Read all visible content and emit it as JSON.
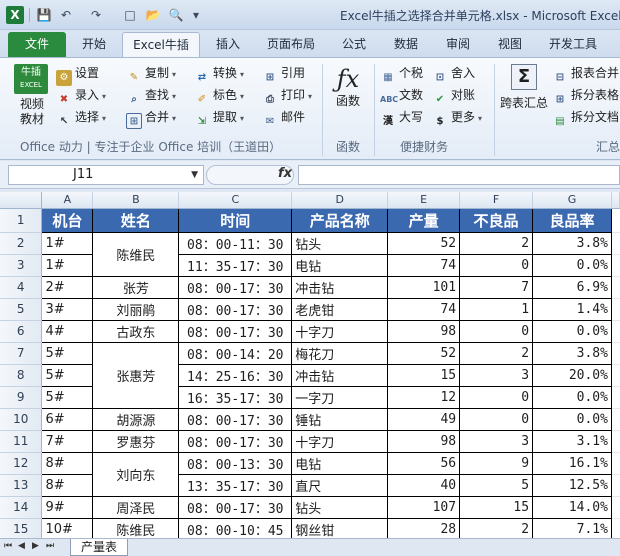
{
  "window": {
    "title": "Excel牛插之选择合并单元格.xlsx - Microsoft Excel"
  },
  "quick_access": {
    "logo": "X",
    "save": "💾",
    "undo": "↶",
    "redo": "↷",
    "new": "□",
    "open": "📂",
    "print": "🔍",
    "more": "▾"
  },
  "tabs": [
    "文件",
    "开始",
    "Excel牛插",
    "插入",
    "页面布局",
    "公式",
    "数据",
    "审阅",
    "视图",
    "开发工具"
  ],
  "ribbon": {
    "logo_top": "牛插",
    "logo_bottom": "EXCEL",
    "logo_caption": "视频\n教材",
    "col1": [
      "设置",
      "录入",
      "选择"
    ],
    "col2": [
      "复制",
      "查找",
      "合并"
    ],
    "col3": [
      "转换",
      "标色",
      "提取"
    ],
    "col4": [
      "引用",
      "打印",
      "邮件"
    ],
    "group1_label": "Office 动力 | 专注于企业 Office 培训（王道田）",
    "func_btn": "函数",
    "func_label": "函数",
    "col5": [
      "个税",
      "文数",
      "大写"
    ],
    "col6": [
      "舍入",
      "对账",
      "更多"
    ],
    "group3_label": "便捷财务",
    "kuabiao": "跨表汇总",
    "col7": [
      "报表合并",
      "拆分表格",
      "拆分文档"
    ],
    "group4_label": "汇总"
  },
  "formula_bar": {
    "name_box": "J11",
    "fx": "fx",
    "formula": ""
  },
  "columns": [
    "A",
    "B",
    "C",
    "D",
    "E",
    "F",
    "G"
  ],
  "table": {
    "headers": [
      "机台",
      "姓名",
      "时间",
      "产品名称",
      "产量",
      "不良品",
      "良品率"
    ],
    "rows": [
      {
        "n": "2",
        "a": "1#",
        "b": "陈维民",
        "b_span": 2,
        "c": "08：00-11：30",
        "d": "钻头",
        "e": "52",
        "f": "2",
        "g": "3.8%"
      },
      {
        "n": "3",
        "a": "1#",
        "c": "11：35-17：30",
        "d": "电钻",
        "e": "74",
        "f": "0",
        "g": "0.0%"
      },
      {
        "n": "4",
        "a": "2#",
        "b": "张芳",
        "b_span": 1,
        "c": "08：00-17：30",
        "d": "冲击钻",
        "e": "101",
        "f": "7",
        "g": "6.9%"
      },
      {
        "n": "5",
        "a": "3#",
        "b": "刘丽鹃",
        "b_span": 1,
        "c": "08：00-17：30",
        "d": "老虎钳",
        "e": "74",
        "f": "1",
        "g": "1.4%"
      },
      {
        "n": "6",
        "a": "4#",
        "b": "古政东",
        "b_span": 1,
        "c": "08：00-17：30",
        "d": "十字刀",
        "e": "98",
        "f": "0",
        "g": "0.0%"
      },
      {
        "n": "7",
        "a": "5#",
        "b": "张惠芳",
        "b_span": 3,
        "c": "08：00-14：20",
        "d": "梅花刀",
        "e": "52",
        "f": "2",
        "g": "3.8%"
      },
      {
        "n": "8",
        "a": "5#",
        "c": "14：25-16：30",
        "d": "冲击钻",
        "e": "15",
        "f": "3",
        "g": "20.0%"
      },
      {
        "n": "9",
        "a": "5#",
        "c": "16：35-17：30",
        "d": "一字刀",
        "e": "12",
        "f": "0",
        "g": "0.0%"
      },
      {
        "n": "10",
        "a": "6#",
        "b": "胡源源",
        "b_span": 1,
        "c": "08：00-17：30",
        "d": "锤钻",
        "e": "49",
        "f": "0",
        "g": "0.0%"
      },
      {
        "n": "11",
        "a": "7#",
        "b": "罗惠芬",
        "b_span": 1,
        "c": "08：00-17：30",
        "d": "十字刀",
        "e": "98",
        "f": "3",
        "g": "3.1%"
      },
      {
        "n": "12",
        "a": "8#",
        "b": "刘向东",
        "b_span": 2,
        "c": "08：00-13：30",
        "d": "电钻",
        "e": "56",
        "f": "9",
        "g": "16.1%"
      },
      {
        "n": "13",
        "a": "8#",
        "c": "13：35-17：30",
        "d": "直尺",
        "e": "40",
        "f": "5",
        "g": "12.5%"
      },
      {
        "n": "14",
        "a": "9#",
        "b": "周泽民",
        "b_span": 1,
        "c": "08：00-17：30",
        "d": "钻头",
        "e": "107",
        "f": "15",
        "g": "14.0%"
      },
      {
        "n": "15",
        "a": "10#",
        "b": "陈维民",
        "b_span": 2,
        "c": "08：00-10：45",
        "d": "钢丝钳",
        "e": "28",
        "f": "2",
        "g": "7.1%"
      }
    ]
  },
  "sheet_tab": "产量表"
}
